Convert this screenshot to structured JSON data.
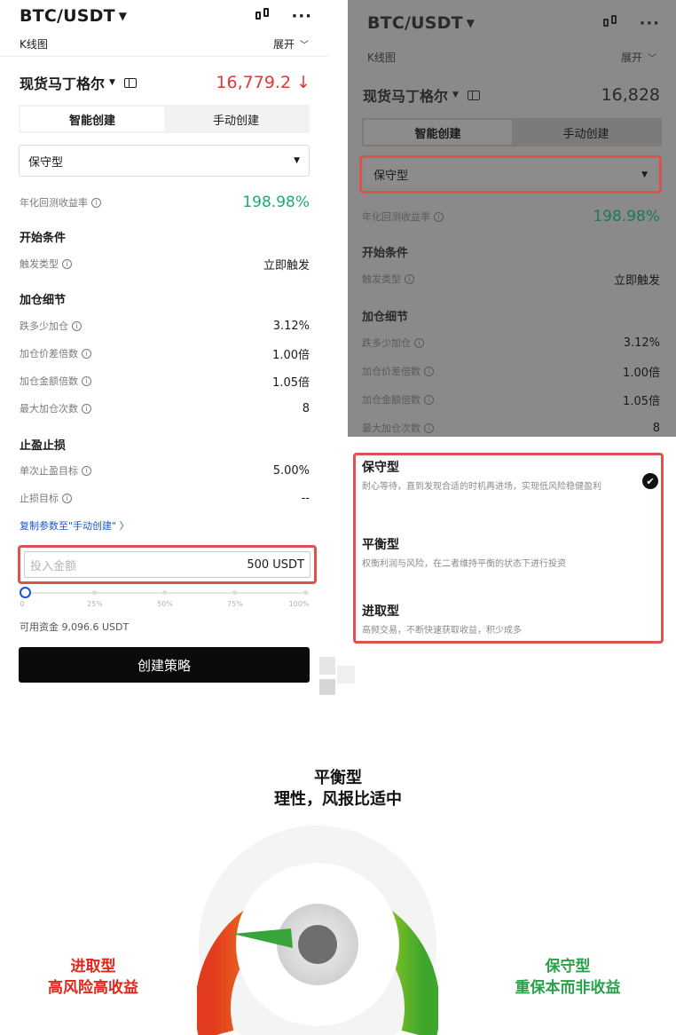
{
  "left": {
    "pair": "BTC/USDT",
    "kline_label": "K线图",
    "expand_label": "展开",
    "product_name": "现货马丁格尔",
    "price": "16,779.2 ↓",
    "tabs": [
      "智能创建",
      "手动创建"
    ],
    "strategy_type": "保守型",
    "annual_return_label": "年化回测收益率",
    "annual_return_value": "198.98%",
    "start_section": "开始条件",
    "trigger_label": "触发类型",
    "trigger_value": "立即触发",
    "add_section": "加仓细节",
    "drop_label": "跌多少加仓",
    "drop_value": "3.12%",
    "spread_mult_label": "加仓价差倍数",
    "spread_mult_value": "1.00倍",
    "amount_mult_label": "加仓金额倍数",
    "amount_mult_value": "1.05倍",
    "max_times_label": "最大加仓次数",
    "max_times_value": "8",
    "tp_section": "止盈止损",
    "tp_label": "单次止盈目标",
    "tp_value": "5.00%",
    "sl_label": "止损目标",
    "sl_value": "--",
    "copy_link": "复制参数至\"手动创建\" 〉",
    "invest_placeholder": "投入金额",
    "invest_value": "500 USDT",
    "slider_labels": [
      "0",
      "25%",
      "50%",
      "75%",
      "100%"
    ],
    "slider_value": 0,
    "available": "可用资金 9,096.6 USDT",
    "create_button": "创建策略"
  },
  "right": {
    "pair": "BTC/USDT",
    "kline_label": "K线图",
    "expand_label": "展开",
    "product_name": "现货马丁格尔",
    "price": "16,828",
    "tabs": [
      "智能创建",
      "手动创建"
    ],
    "strategy_type": "保守型",
    "annual_return_label": "年化回测收益率",
    "annual_return_value": "198.98%",
    "start_section": "开始条件",
    "trigger_label": "触发类型",
    "trigger_value": "立即触发",
    "add_section": "加仓细节",
    "drop_label": "跌多少加仓",
    "drop_value": "3.12%",
    "spread_mult_label": "加仓价差倍数",
    "spread_mult_value": "1.00倍",
    "amount_mult_label": "加仓金额倍数",
    "amount_mult_value": "1.05倍",
    "max_times_label": "最大加仓次数",
    "max_times_value": "8",
    "options": [
      {
        "title": "保守型",
        "desc": "耐心等待，直到发现合适的时机再进场，实现低风险稳健盈利",
        "selected": true
      },
      {
        "title": "平衡型",
        "desc": "权衡利润与风险，在二者维持平衡的状态下进行投资",
        "selected": false
      },
      {
        "title": "进取型",
        "desc": "高频交易，不断快速获取收益，积少成多",
        "selected": false
      }
    ]
  },
  "gauge": {
    "top_title": "平衡型",
    "top_subtitle": "理性，风报比适中",
    "left_title": "进取型",
    "left_subtitle": "高风险高收益",
    "right_title": "保守型",
    "right_subtitle": "重保本而非收益"
  },
  "colors": {
    "up_down_red": "#d93a34",
    "green_return": "#1ea87a",
    "highlight_red": "#d9534f",
    "link_blue": "#1b57c9",
    "aggressive_red": "#e0261a",
    "conservative_green": "#2aa24a"
  }
}
